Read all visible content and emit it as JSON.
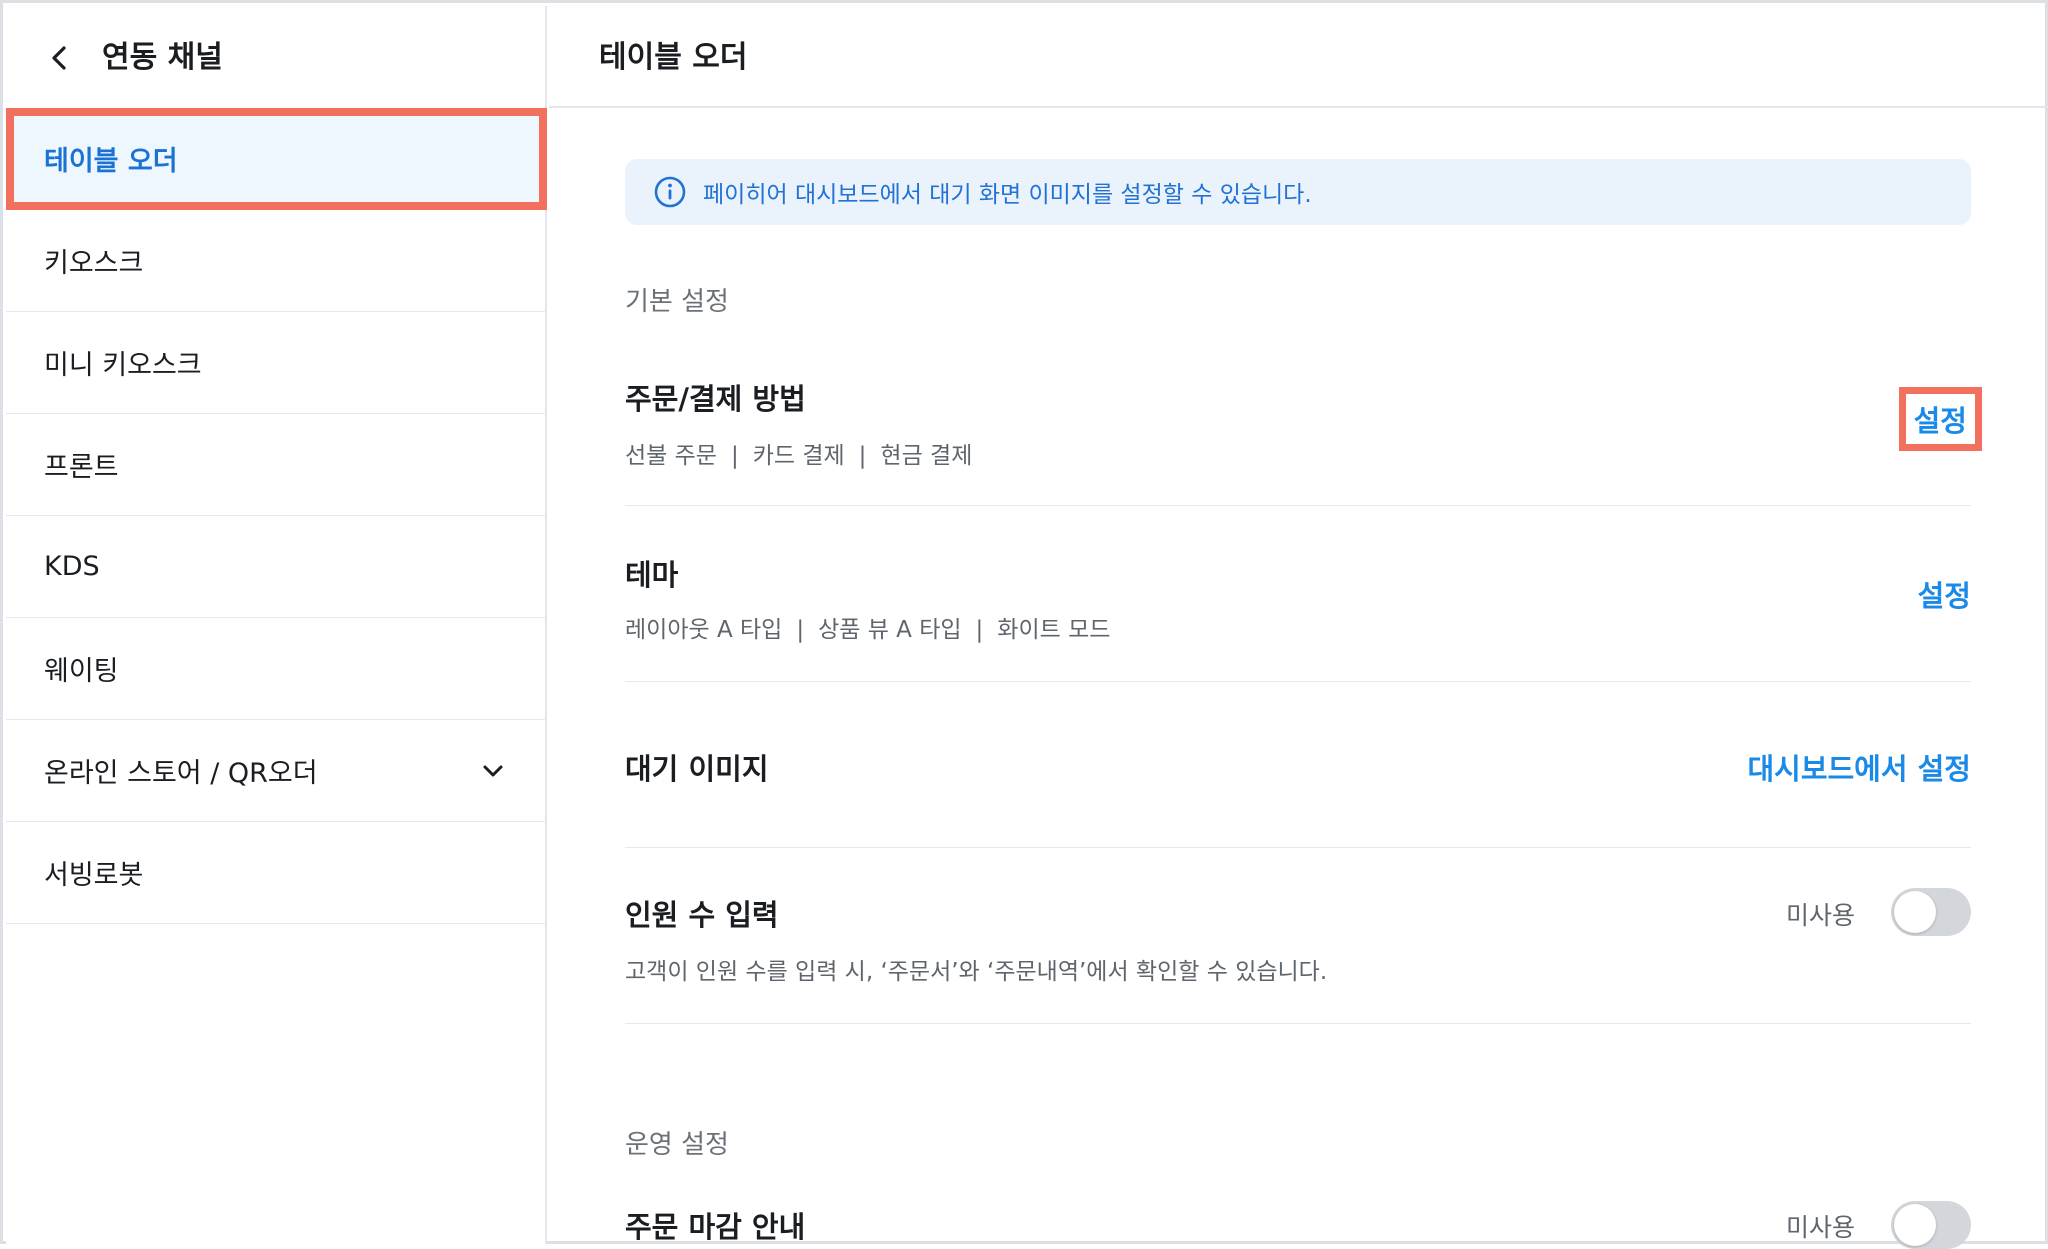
{
  "sidebar": {
    "title": "연동 채널",
    "items": [
      {
        "label": "테이블 오더",
        "active": true
      },
      {
        "label": "키오스크"
      },
      {
        "label": "미니 키오스크"
      },
      {
        "label": "프론트"
      },
      {
        "label": "KDS"
      },
      {
        "label": "웨이팅"
      },
      {
        "label": "온라인 스토어 / QR오더",
        "expandable": true
      },
      {
        "label": "서빙로봇"
      }
    ]
  },
  "main": {
    "title": "테이블 오더",
    "info_banner": "페이히어 대시보드에서 대기 화면 이미지를 설정할 수 있습니다.",
    "basic_section": "기본 설정",
    "order_payment": {
      "title": "주문/결제 방법",
      "options": [
        "선불 주문",
        "카드 결제",
        "현금 결제"
      ],
      "action": "설정"
    },
    "theme": {
      "title": "테마",
      "options": [
        "레이아웃 A 타입",
        "상품 뷰 A 타입",
        "화이트 모드"
      ],
      "action": "설정"
    },
    "standby_image": {
      "title": "대기 이미지",
      "action": "대시보드에서 설정"
    },
    "headcount": {
      "title": "인원 수 입력",
      "desc": "고객이 인원 수를 입력 시, ‘주문서’와 ‘주문내역’에서 확인할 수 있습니다.",
      "status": "미사용",
      "enabled": false
    },
    "operation_section": "운영 설정",
    "order_close": {
      "title": "주문 마감 안내",
      "status": "미사용",
      "enabled": false
    }
  },
  "colors": {
    "accent": "#1a8ae8",
    "highlight": "#f2715e",
    "active_bg": "#eef6fe",
    "banner_bg": "#eaf2fc"
  }
}
